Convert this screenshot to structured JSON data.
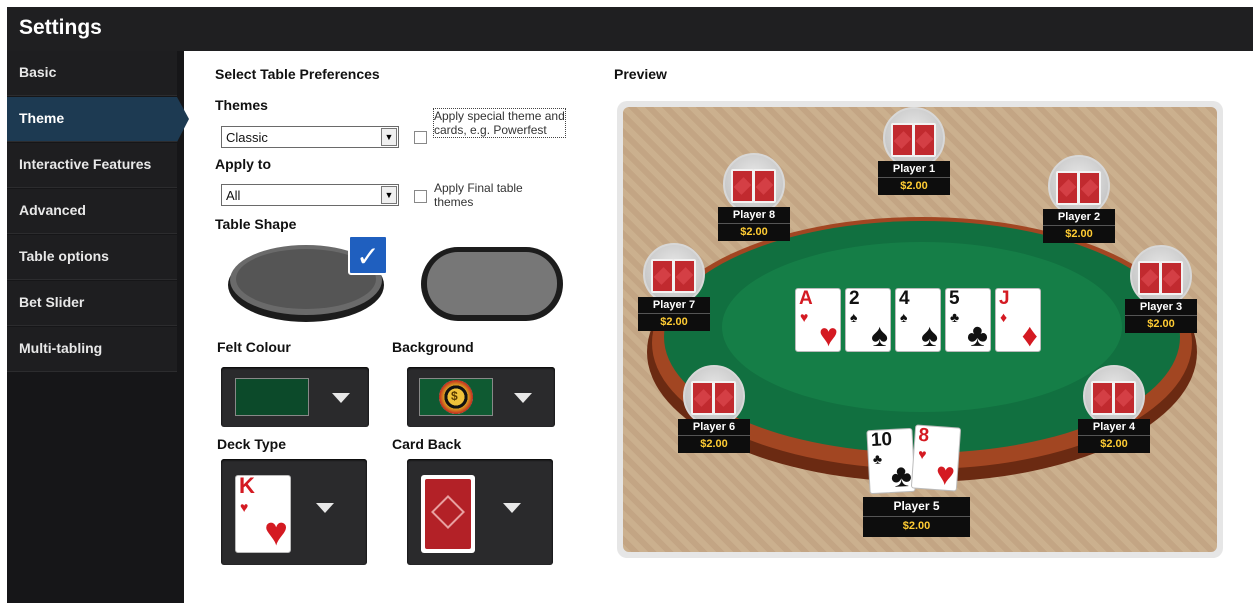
{
  "window": {
    "title": "Settings"
  },
  "sidebar": {
    "items": [
      {
        "label": "Basic"
      },
      {
        "label": "Theme",
        "active": true
      },
      {
        "label": "Interactive Features"
      },
      {
        "label": "Advanced"
      },
      {
        "label": "Table options"
      },
      {
        "label": "Bet Slider"
      },
      {
        "label": "Multi-tabling"
      }
    ]
  },
  "preferences": {
    "heading": "Select Table Preferences",
    "themes_label": "Themes",
    "themes_value": "Classic",
    "special_theme_text": "Apply special theme and cards, e.g. Powerfest",
    "apply_to_label": "Apply to",
    "apply_to_value": "All",
    "final_table_text": "Apply Final table themes",
    "table_shape_label": "Table Shape",
    "felt_label": "Felt Colour",
    "background_label": "Background",
    "deck_label": "Deck Type",
    "cardback_label": "Card Back",
    "deck_rank": "K",
    "deck_suit": "♥",
    "checkmark": "✓",
    "chip_symbol": "$",
    "felt_color": "#0c4a2a"
  },
  "preview": {
    "label": "Preview",
    "board": [
      {
        "rank": "A",
        "suit": "♥",
        "color": "red"
      },
      {
        "rank": "2",
        "suit": "♠",
        "color": "blk"
      },
      {
        "rank": "4",
        "suit": "♠",
        "color": "blk"
      },
      {
        "rank": "5",
        "suit": "♣",
        "color": "blk"
      },
      {
        "rank": "J",
        "suit": "♦",
        "color": "red"
      }
    ],
    "hero_cards": [
      {
        "rank": "10",
        "suit": "♣",
        "color": "blk"
      },
      {
        "rank": "8",
        "suit": "♥",
        "color": "red"
      }
    ],
    "players": [
      {
        "name": "Player 1",
        "amount": "$2.00"
      },
      {
        "name": "Player 2",
        "amount": "$2.00"
      },
      {
        "name": "Player 3",
        "amount": "$2.00"
      },
      {
        "name": "Player 4",
        "amount": "$2.00"
      },
      {
        "name": "Player 5",
        "amount": "$2.00"
      },
      {
        "name": "Player 6",
        "amount": "$2.00"
      },
      {
        "name": "Player 7",
        "amount": "$2.00"
      },
      {
        "name": "Player 8",
        "amount": "$2.00"
      }
    ]
  },
  "colors": {
    "sidebar_active": "#1d3a52",
    "felt": "#0f6d3a",
    "rail": "#8a3b1c",
    "accent_check": "#1f5fbf"
  }
}
